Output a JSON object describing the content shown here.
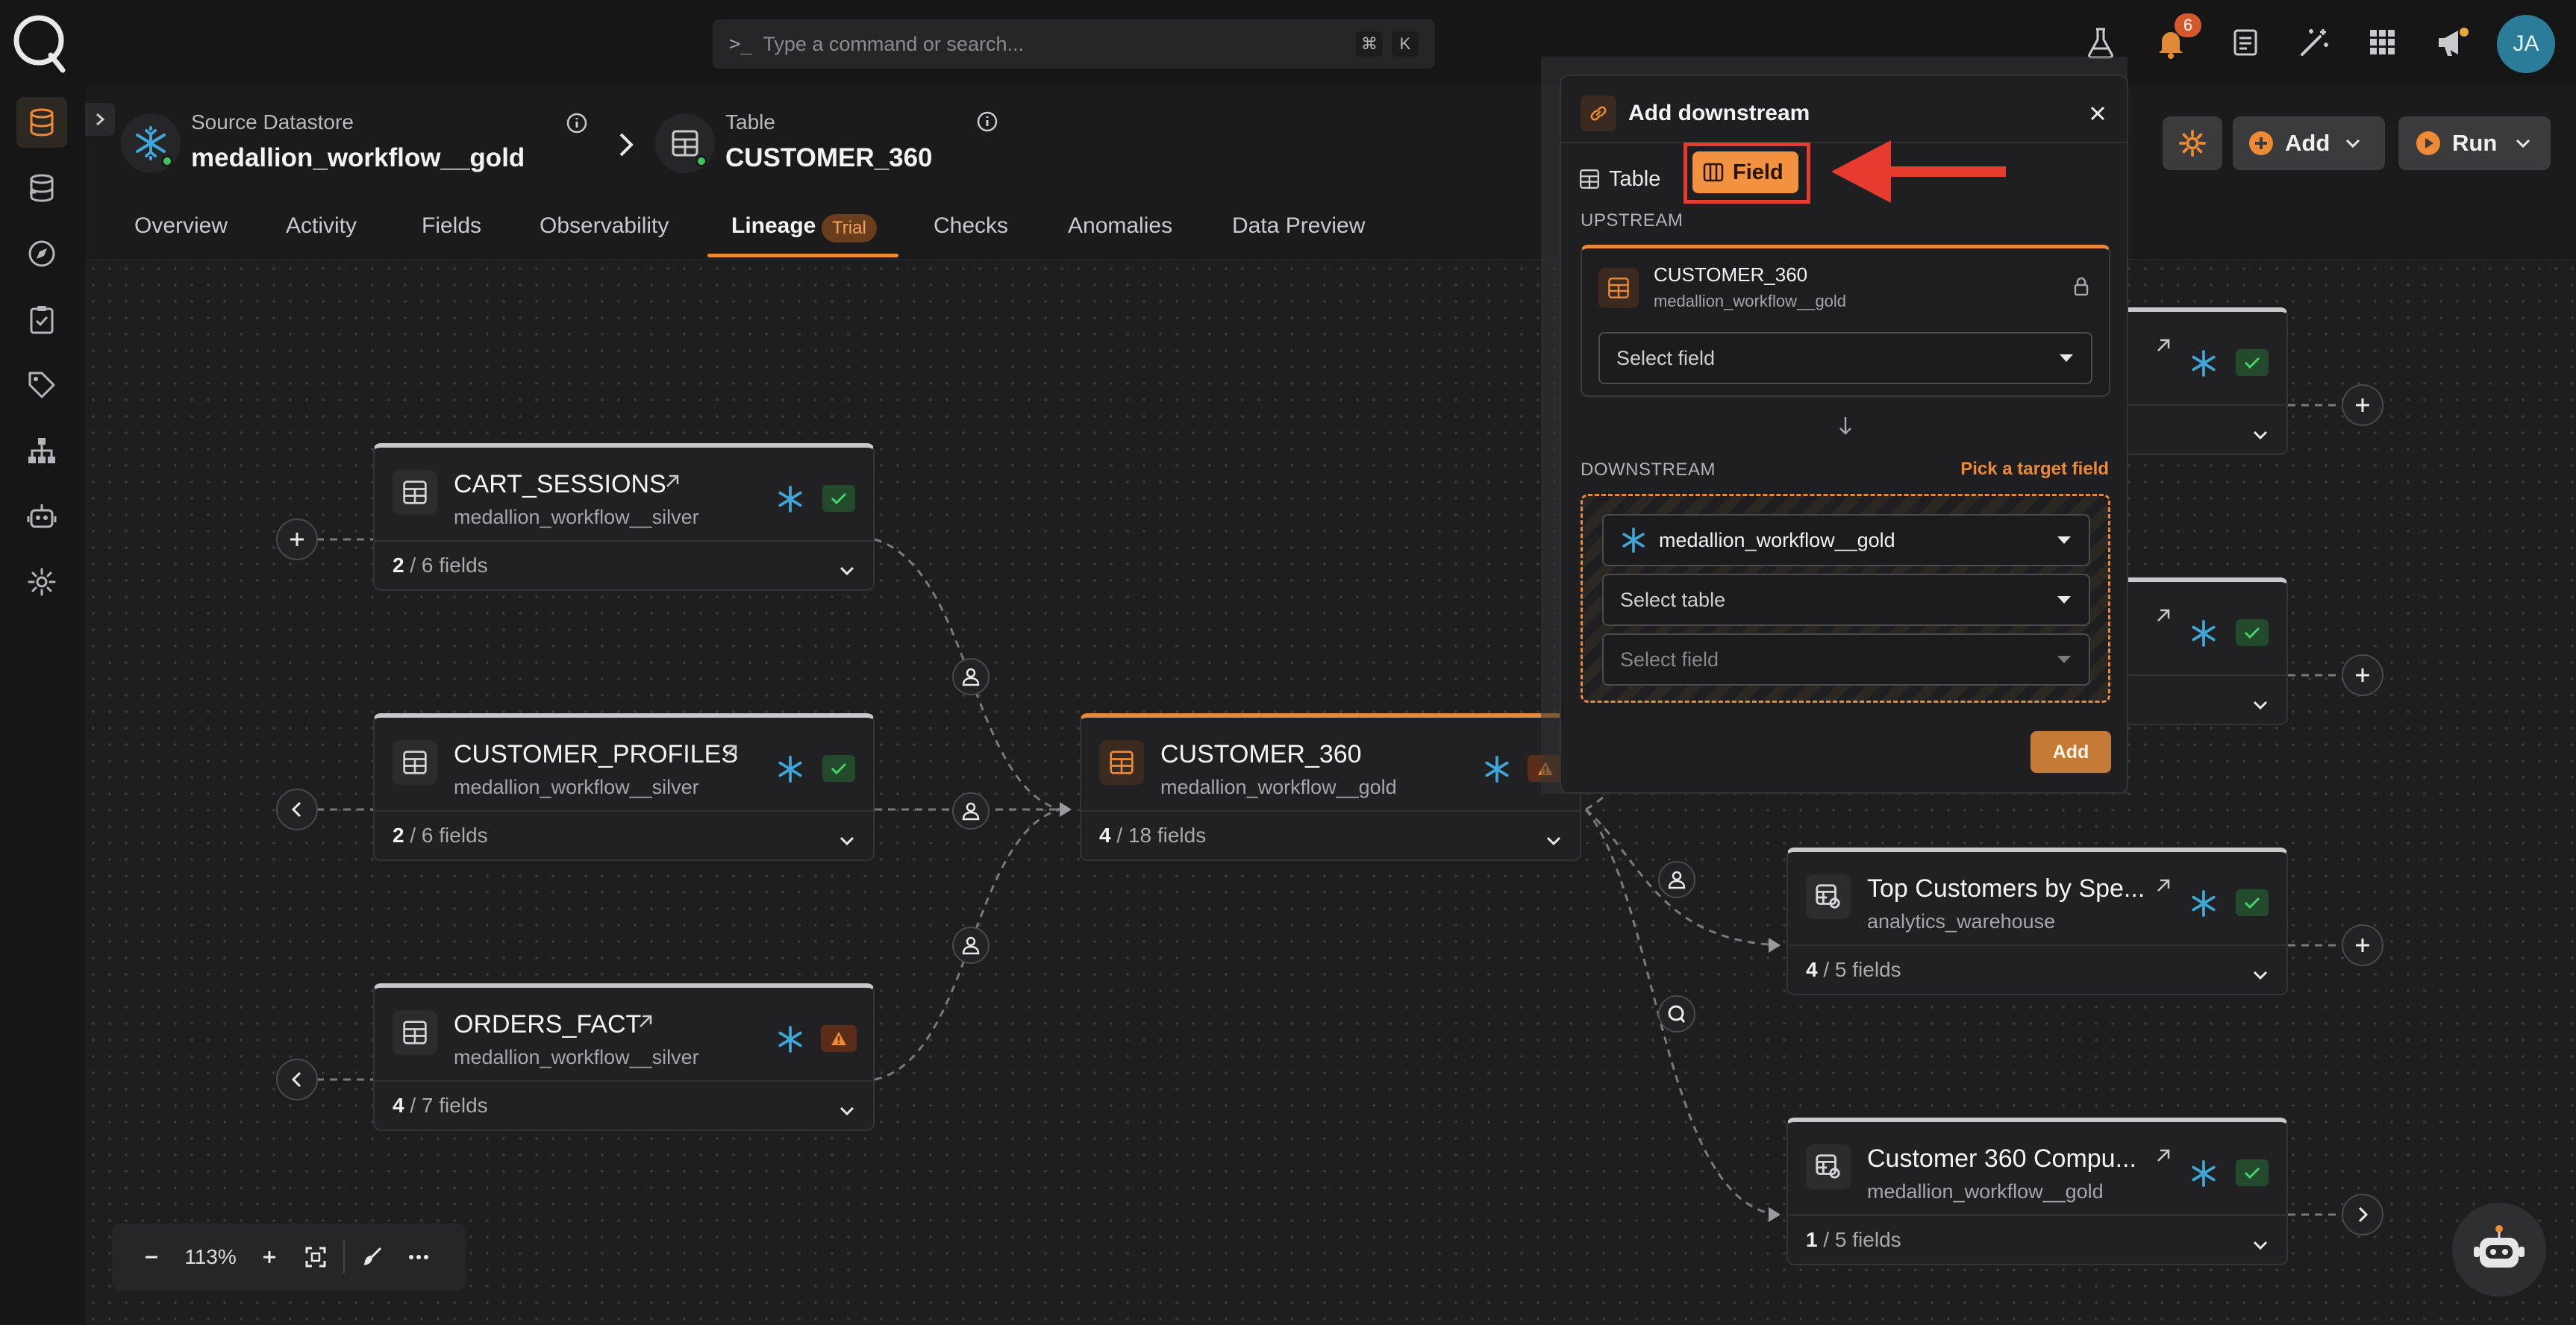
{
  "colors": {
    "accent": "#ec8a35",
    "danger": "#e63b2e",
    "success": "#3cc45f",
    "snowflake": "#3fa6d8"
  },
  "search": {
    "placeholder": "Type a command or search...",
    "shortcut_mod": "⌘",
    "shortcut_key": "K"
  },
  "topbar": {
    "notifications_count": "6",
    "avatar_initials": "JA",
    "icons": [
      "flask-icon",
      "bell-icon",
      "docs-icon",
      "magic-wand-icon",
      "apps-grid-icon",
      "megaphone-icon"
    ]
  },
  "sidebar": {
    "items": [
      "database-icon",
      "datastores-icon",
      "explore-icon",
      "checks-icon",
      "tags-icon",
      "hierarchy-icon",
      "agent-icon",
      "settings-icon"
    ]
  },
  "breadcrumb": {
    "source_label": "Source Datastore",
    "source_value": "medallion_workflow__gold",
    "table_label": "Table",
    "table_value": "CUSTOMER_360"
  },
  "tabs": [
    {
      "label": "Overview"
    },
    {
      "label": "Activity"
    },
    {
      "label": "Fields"
    },
    {
      "label": "Observability"
    },
    {
      "label": "Lineage",
      "badge": "Trial",
      "active": true
    },
    {
      "label": "Checks"
    },
    {
      "label": "Anomalies"
    },
    {
      "label": "Data Preview"
    }
  ],
  "header_buttons": {
    "add": "Add",
    "run": "Run"
  },
  "nodes": {
    "cart_sessions": {
      "name": "CART_SESSIONS",
      "sub": "medallion_workflow__silver",
      "fields_count": "2",
      "fields_total": "/ 6 fields"
    },
    "customer_profiles": {
      "name": "CUSTOMER_PROFILES",
      "sub": "medallion_workflow__silver",
      "fields_count": "2",
      "fields_total": "/ 6 fields"
    },
    "orders_fact": {
      "name": "ORDERS_FACT",
      "sub": "medallion_workflow__silver",
      "fields_count": "4",
      "fields_total": "/ 7 fields"
    },
    "customer_360": {
      "name": "CUSTOMER_360",
      "sub": "medallion_workflow__gold",
      "fields_count": "4",
      "fields_total": "/ 18 fields"
    },
    "top_customers": {
      "name": "Top Customers by Spe...",
      "sub": "analytics_warehouse",
      "fields_count": "4",
      "fields_total": "/ 5 fields"
    },
    "customer_360_compute": {
      "name": "Customer 360 Compu...",
      "sub": "medallion_workflow__gold",
      "fields_count": "1",
      "fields_total": "/ 5 fields"
    }
  },
  "zoom": {
    "value": "113%"
  },
  "dialog": {
    "title": "Add downstream",
    "mode_table": "Table",
    "mode_field": "Field",
    "upstream_label": "UPSTREAM",
    "upstream_table": "CUSTOMER_360",
    "upstream_datastore": "medallion_workflow__gold",
    "upstream_field_placeholder": "Select field",
    "downstream_label": "DOWNSTREAM",
    "downstream_hint": "Pick a target field",
    "downstream_datastore": "medallion_workflow__gold",
    "downstream_table_placeholder": "Select table",
    "downstream_field_placeholder": "Select field",
    "add_button": "Add"
  }
}
